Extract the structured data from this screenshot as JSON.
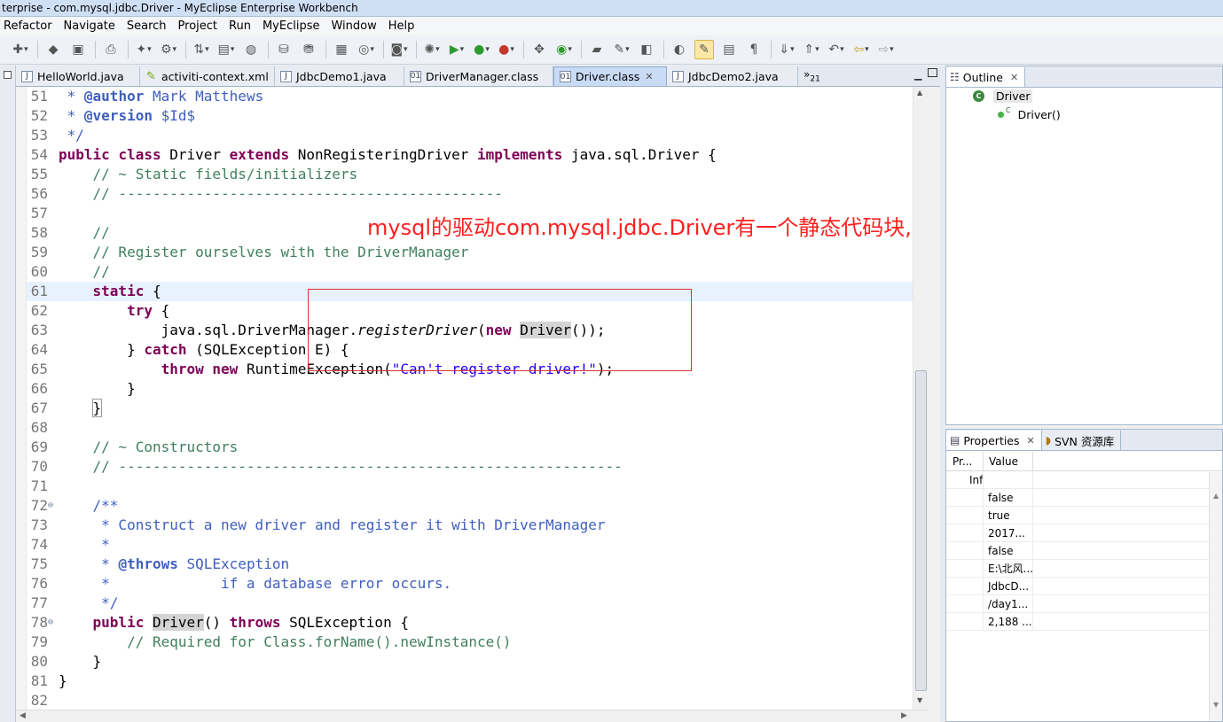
{
  "window": {
    "title": "terprise - com.mysql.jdbc.Driver - MyEclipse Enterprise Workbench"
  },
  "menu": [
    "Refactor",
    "Navigate",
    "Search",
    "Project",
    "Run",
    "MyEclipse",
    "Window",
    "Help"
  ],
  "editor_tabs": [
    {
      "label": "HelloWorld.java",
      "icon": "java-file-icon",
      "active": false
    },
    {
      "label": "activiti-context.xml",
      "icon": "xml-file-icon",
      "active": false
    },
    {
      "label": "JdbcDemo1.java",
      "icon": "java-file-icon",
      "active": false
    },
    {
      "label": "DriverManager.class",
      "icon": "class-file-icon",
      "active": false
    },
    {
      "label": "Driver.class",
      "icon": "class-file-icon",
      "active": true
    },
    {
      "label": "JdbcDemo2.java",
      "icon": "java-file-icon",
      "active": false
    }
  ],
  "tab_overflow": {
    "symbol": "»",
    "count": "21"
  },
  "annotation": "mysql的驱动com.mysql.jdbc.Driver有一个静态代码块,又注册一次驱动程序",
  "code": {
    "lines": [
      {
        "n": "51",
        "text": " * @author Mark Matthews"
      },
      {
        "n": "52",
        "text": " * @version $Id$"
      },
      {
        "n": "53",
        "text": " */"
      },
      {
        "n": "54",
        "text": "public class Driver extends NonRegisteringDriver implements java.sql.Driver {"
      },
      {
        "n": "55",
        "text": "    // ~ Static fields/initializers"
      },
      {
        "n": "56",
        "text": "    // ---------------------------------------------"
      },
      {
        "n": "57",
        "text": ""
      },
      {
        "n": "58",
        "text": "    //"
      },
      {
        "n": "59",
        "text": "    // Register ourselves with the DriverManager"
      },
      {
        "n": "60",
        "text": "    //"
      },
      {
        "n": "61",
        "text": "    static {"
      },
      {
        "n": "62",
        "text": "        try {"
      },
      {
        "n": "63",
        "text": "            java.sql.DriverManager.registerDriver(new Driver());"
      },
      {
        "n": "64",
        "text": "        } catch (SQLException E) {"
      },
      {
        "n": "65",
        "text": "            throw new RuntimeException(\"Can't register driver!\");"
      },
      {
        "n": "66",
        "text": "        }"
      },
      {
        "n": "67",
        "text": "    }"
      },
      {
        "n": "68",
        "text": ""
      },
      {
        "n": "69",
        "text": "    // ~ Constructors"
      },
      {
        "n": "70",
        "text": "    // -----------------------------------------------------------"
      },
      {
        "n": "71",
        "text": ""
      },
      {
        "n": "72",
        "text": "    /**"
      },
      {
        "n": "73",
        "text": "     * Construct a new driver and register it with DriverManager"
      },
      {
        "n": "74",
        "text": "     *"
      },
      {
        "n": "75",
        "text": "     * @throws SQLException"
      },
      {
        "n": "76",
        "text": "     *             if a database error occurs."
      },
      {
        "n": "77",
        "text": "     */"
      },
      {
        "n": "78",
        "text": "    public Driver() throws SQLException {"
      },
      {
        "n": "79",
        "text": "        // Required for Class.forName().newInstance()"
      },
      {
        "n": "80",
        "text": "    }"
      },
      {
        "n": "81",
        "text": "}"
      },
      {
        "n": "82",
        "text": ""
      }
    ]
  },
  "outline": {
    "tab_label": "Outline",
    "class_node": "Driver",
    "constructor_node": "Driver()",
    "constructor_modifier": "C"
  },
  "properties": {
    "tab_label": "Properties",
    "svn_tab_label": "SVN 资源库",
    "columns": [
      "Pr...",
      "Value"
    ],
    "rows": [
      {
        "prop": "Inf",
        "value": ""
      },
      {
        "prop": "",
        "value": "false"
      },
      {
        "prop": "",
        "value": "true"
      },
      {
        "prop": "",
        "value": "2017..."
      },
      {
        "prop": "",
        "value": "false"
      },
      {
        "prop": "",
        "value": "E:\\北风..."
      },
      {
        "prop": "",
        "value": "JdbcD..."
      },
      {
        "prop": "",
        "value": "/day1..."
      },
      {
        "prop": "",
        "value": "2,188 ..."
      }
    ]
  },
  "colors": {
    "keyword": "#7f0055",
    "comment": "#3f7f5f",
    "javadoc": "#3f5fbf",
    "string": "#2a00ff",
    "annotation": "#ff2020",
    "current_line": "#e8f2fe"
  }
}
